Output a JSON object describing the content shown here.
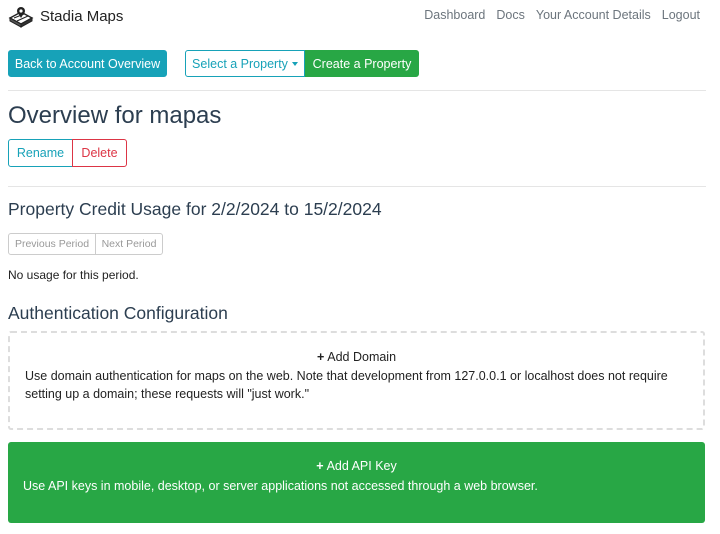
{
  "navbar": {
    "brand": "Stadia Maps",
    "links": [
      "Dashboard",
      "Docs",
      "Your Account Details",
      "Logout"
    ]
  },
  "toolbar": {
    "back_label": "Back to Account Overview",
    "select_label": "Select a Property",
    "create_label": "Create a Property"
  },
  "property": {
    "title": "Overview for mapas",
    "rename_label": "Rename",
    "delete_label": "Delete"
  },
  "usage": {
    "title": "Property Credit Usage for 2/2/2024 to 15/2/2024",
    "prev_label": "Previous Period",
    "next_label": "Next Period",
    "empty_text": "No usage for this period."
  },
  "auth": {
    "title": "Authentication Configuration",
    "domain": {
      "heading": "Add Domain",
      "text": "Use domain authentication for maps on the web. Note that development from 127.0.0.1 or localhost does not require setting up a domain; these requests will \"just work.\""
    },
    "apikey": {
      "heading": "Add API Key",
      "text": "Use API keys in mobile, desktop, or server applications not accessed through a web browser."
    }
  },
  "colors": {
    "info": "#17a2b8",
    "success": "#28a745",
    "danger": "#dc3545"
  },
  "icons": {
    "brand": "stadia-logo-icon",
    "add": "plus-icon",
    "dropdown": "caret-down-icon"
  }
}
